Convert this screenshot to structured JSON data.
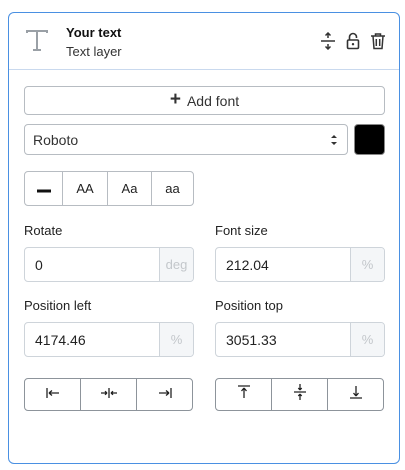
{
  "layer": {
    "title": "Your text",
    "subtitle": "Text layer",
    "icon": "text-type-icon",
    "actions": [
      "resize-vertical-icon",
      "unlock-icon",
      "trash-icon"
    ]
  },
  "font": {
    "add_label": "Add font",
    "selected": "Roboto",
    "color": "#000000"
  },
  "text_case": {
    "options": [
      "AA",
      "Aa",
      "aa"
    ],
    "none_icon": "dash-icon"
  },
  "rotate": {
    "label": "Rotate",
    "value": "0",
    "unit": "deg"
  },
  "font_size": {
    "label": "Font size",
    "value": "212.04",
    "unit": "%"
  },
  "position_left": {
    "label": "Position left",
    "value": "4174.46",
    "unit": "%"
  },
  "position_top": {
    "label": "Position top",
    "value": "3051.33",
    "unit": "%"
  },
  "horizontal_align": [
    "align-left-icon",
    "align-center-horizontal-icon",
    "align-right-icon"
  ],
  "vertical_align": [
    "align-top-icon",
    "align-middle-vertical-icon",
    "align-bottom-icon"
  ]
}
